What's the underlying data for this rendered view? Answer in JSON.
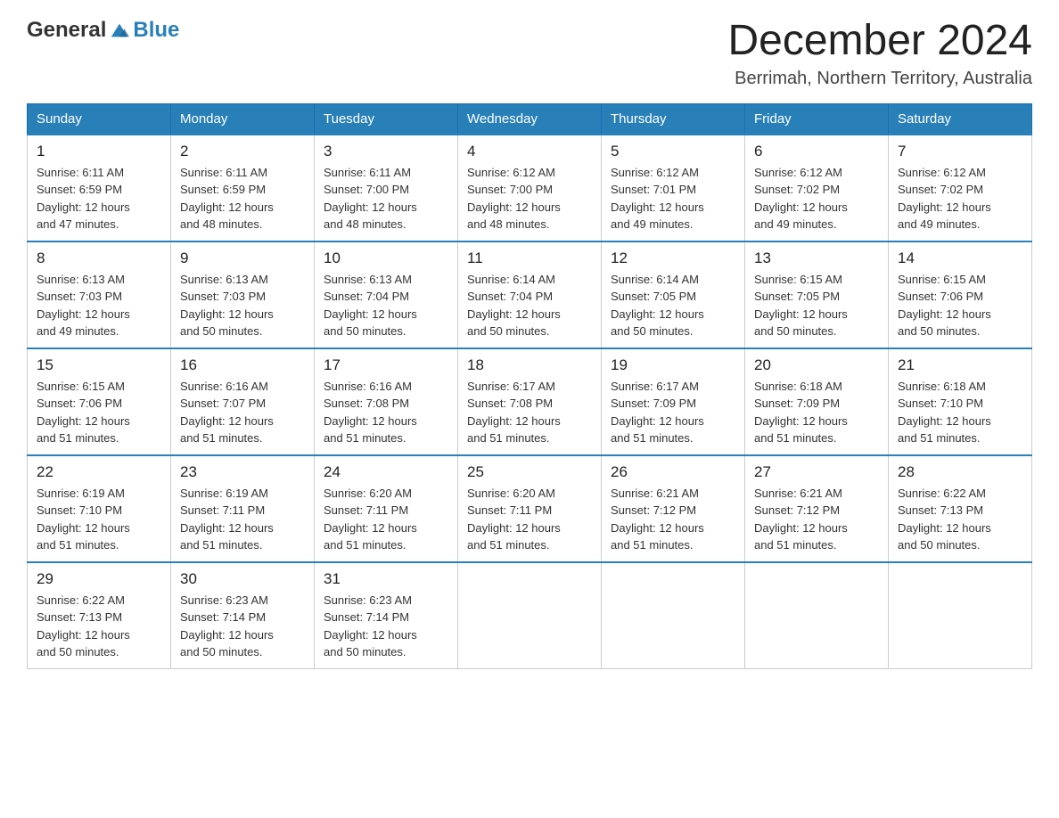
{
  "logo": {
    "text_general": "General",
    "text_blue": "Blue"
  },
  "header": {
    "month_title": "December 2024",
    "location": "Berrimah, Northern Territory, Australia"
  },
  "days_of_week": [
    "Sunday",
    "Monday",
    "Tuesday",
    "Wednesday",
    "Thursday",
    "Friday",
    "Saturday"
  ],
  "weeks": [
    [
      {
        "day": "1",
        "sunrise": "6:11 AM",
        "sunset": "6:59 PM",
        "daylight": "12 hours and 47 minutes."
      },
      {
        "day": "2",
        "sunrise": "6:11 AM",
        "sunset": "6:59 PM",
        "daylight": "12 hours and 48 minutes."
      },
      {
        "day": "3",
        "sunrise": "6:11 AM",
        "sunset": "7:00 PM",
        "daylight": "12 hours and 48 minutes."
      },
      {
        "day": "4",
        "sunrise": "6:12 AM",
        "sunset": "7:00 PM",
        "daylight": "12 hours and 48 minutes."
      },
      {
        "day": "5",
        "sunrise": "6:12 AM",
        "sunset": "7:01 PM",
        "daylight": "12 hours and 49 minutes."
      },
      {
        "day": "6",
        "sunrise": "6:12 AM",
        "sunset": "7:02 PM",
        "daylight": "12 hours and 49 minutes."
      },
      {
        "day": "7",
        "sunrise": "6:12 AM",
        "sunset": "7:02 PM",
        "daylight": "12 hours and 49 minutes."
      }
    ],
    [
      {
        "day": "8",
        "sunrise": "6:13 AM",
        "sunset": "7:03 PM",
        "daylight": "12 hours and 49 minutes."
      },
      {
        "day": "9",
        "sunrise": "6:13 AM",
        "sunset": "7:03 PM",
        "daylight": "12 hours and 50 minutes."
      },
      {
        "day": "10",
        "sunrise": "6:13 AM",
        "sunset": "7:04 PM",
        "daylight": "12 hours and 50 minutes."
      },
      {
        "day": "11",
        "sunrise": "6:14 AM",
        "sunset": "7:04 PM",
        "daylight": "12 hours and 50 minutes."
      },
      {
        "day": "12",
        "sunrise": "6:14 AM",
        "sunset": "7:05 PM",
        "daylight": "12 hours and 50 minutes."
      },
      {
        "day": "13",
        "sunrise": "6:15 AM",
        "sunset": "7:05 PM",
        "daylight": "12 hours and 50 minutes."
      },
      {
        "day": "14",
        "sunrise": "6:15 AM",
        "sunset": "7:06 PM",
        "daylight": "12 hours and 50 minutes."
      }
    ],
    [
      {
        "day": "15",
        "sunrise": "6:15 AM",
        "sunset": "7:06 PM",
        "daylight": "12 hours and 51 minutes."
      },
      {
        "day": "16",
        "sunrise": "6:16 AM",
        "sunset": "7:07 PM",
        "daylight": "12 hours and 51 minutes."
      },
      {
        "day": "17",
        "sunrise": "6:16 AM",
        "sunset": "7:08 PM",
        "daylight": "12 hours and 51 minutes."
      },
      {
        "day": "18",
        "sunrise": "6:17 AM",
        "sunset": "7:08 PM",
        "daylight": "12 hours and 51 minutes."
      },
      {
        "day": "19",
        "sunrise": "6:17 AM",
        "sunset": "7:09 PM",
        "daylight": "12 hours and 51 minutes."
      },
      {
        "day": "20",
        "sunrise": "6:18 AM",
        "sunset": "7:09 PM",
        "daylight": "12 hours and 51 minutes."
      },
      {
        "day": "21",
        "sunrise": "6:18 AM",
        "sunset": "7:10 PM",
        "daylight": "12 hours and 51 minutes."
      }
    ],
    [
      {
        "day": "22",
        "sunrise": "6:19 AM",
        "sunset": "7:10 PM",
        "daylight": "12 hours and 51 minutes."
      },
      {
        "day": "23",
        "sunrise": "6:19 AM",
        "sunset": "7:11 PM",
        "daylight": "12 hours and 51 minutes."
      },
      {
        "day": "24",
        "sunrise": "6:20 AM",
        "sunset": "7:11 PM",
        "daylight": "12 hours and 51 minutes."
      },
      {
        "day": "25",
        "sunrise": "6:20 AM",
        "sunset": "7:11 PM",
        "daylight": "12 hours and 51 minutes."
      },
      {
        "day": "26",
        "sunrise": "6:21 AM",
        "sunset": "7:12 PM",
        "daylight": "12 hours and 51 minutes."
      },
      {
        "day": "27",
        "sunrise": "6:21 AM",
        "sunset": "7:12 PM",
        "daylight": "12 hours and 51 minutes."
      },
      {
        "day": "28",
        "sunrise": "6:22 AM",
        "sunset": "7:13 PM",
        "daylight": "12 hours and 50 minutes."
      }
    ],
    [
      {
        "day": "29",
        "sunrise": "6:22 AM",
        "sunset": "7:13 PM",
        "daylight": "12 hours and 50 minutes."
      },
      {
        "day": "30",
        "sunrise": "6:23 AM",
        "sunset": "7:14 PM",
        "daylight": "12 hours and 50 minutes."
      },
      {
        "day": "31",
        "sunrise": "6:23 AM",
        "sunset": "7:14 PM",
        "daylight": "12 hours and 50 minutes."
      },
      null,
      null,
      null,
      null
    ]
  ],
  "labels": {
    "sunrise": "Sunrise:",
    "sunset": "Sunset:",
    "daylight": "Daylight:"
  }
}
